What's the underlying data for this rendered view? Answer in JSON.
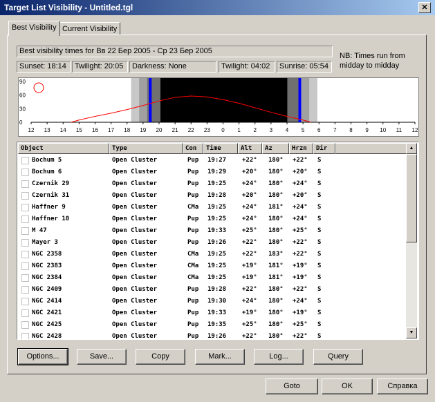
{
  "window": {
    "title": "Target List Visibility - Untitled.tgl",
    "close_glyph": "✕"
  },
  "tabs": [
    {
      "label": "Best Visibility"
    },
    {
      "label": "Current Visibility"
    }
  ],
  "info": {
    "header": "Best visibility times for Вв 22 Бер 2005 - Ср 23 Бер 2005",
    "sunset": "Sunset: 18:14",
    "twilight_evening": "Twilight: 20:05",
    "darkness": "Darkness: None",
    "twilight_morning": "Twilight: 04:02",
    "sunrise": "Sunrise: 05:54",
    "note": "NB: Times run from midday to midday"
  },
  "chart_data": {
    "type": "line",
    "y_ticks": [
      "90",
      "60",
      "30",
      "0"
    ],
    "x_ticks": [
      "12",
      "13",
      "14",
      "15",
      "16",
      "17",
      "18",
      "19",
      "20",
      "21",
      "22",
      "23",
      "0",
      "1",
      "2",
      "3",
      "4",
      "5",
      "6",
      "7",
      "8",
      "9",
      "10",
      "11",
      "12"
    ],
    "ylim": [
      0,
      90
    ],
    "x_hours": [
      14.5,
      15,
      16,
      17,
      18,
      19,
      20,
      21,
      22,
      23,
      0,
      1,
      2,
      3,
      4,
      5,
      5.5
    ],
    "altitude": [
      0,
      5,
      13,
      20,
      28,
      37,
      47,
      55,
      58,
      56,
      50,
      42,
      32,
      22,
      13,
      5,
      0
    ],
    "series": [
      {
        "name": "",
        "color": "#ff0000"
      }
    ],
    "sky_shading": [
      {
        "from": 18.25,
        "to": 18.75,
        "color": "#c8c8c8"
      },
      {
        "from": 18.75,
        "to": 19.25,
        "color": "#a0a0a0"
      },
      {
        "from": 19.25,
        "to": 20.08,
        "color": "#707070"
      },
      {
        "from": 20.08,
        "to": 4.03,
        "color": "#000000"
      },
      {
        "from": 4.03,
        "to": 4.9,
        "color": "#707070"
      },
      {
        "from": 4.9,
        "to": 5.4,
        "color": "#a0a0a0"
      },
      {
        "from": 5.4,
        "to": 5.9,
        "color": "#c8c8c8"
      }
    ],
    "markers": [
      {
        "hour": 19.45,
        "color": "#0000ff"
      },
      {
        "hour": 4.8,
        "color": "#0000ff"
      }
    ],
    "moon_symbol_color": "#ff0000"
  },
  "table": {
    "columns": [
      "Object",
      "Type",
      "Con",
      "Time",
      "Alt",
      "Az",
      "Hrzn",
      "Dir"
    ],
    "rows": [
      [
        "Bochum 5",
        "Open Cluster",
        "Pup",
        "19:27",
        "+22°",
        "180°",
        "+22°",
        "S"
      ],
      [
        "Bochum 6",
        "Open Cluster",
        "Pup",
        "19:29",
        "+20°",
        "180°",
        "+20°",
        "S"
      ],
      [
        "Czernik 29",
        "Open Cluster",
        "Pup",
        "19:25",
        "+24°",
        "180°",
        "+24°",
        "S"
      ],
      [
        "Czernik 31",
        "Open Cluster",
        "Pup",
        "19:28",
        "+20°",
        "180°",
        "+20°",
        "S"
      ],
      [
        "Haffner 9",
        "Open Cluster",
        "CMa",
        "19:25",
        "+24°",
        "181°",
        "+24°",
        "S"
      ],
      [
        "Haffner 10",
        "Open Cluster",
        "Pup",
        "19:25",
        "+24°",
        "180°",
        "+24°",
        "S"
      ],
      [
        "M 47",
        "Open Cluster",
        "Pup",
        "19:33",
        "+25°",
        "180°",
        "+25°",
        "S"
      ],
      [
        "Mayer 3",
        "Open Cluster",
        "Pup",
        "19:26",
        "+22°",
        "180°",
        "+22°",
        "S"
      ],
      [
        "NGC 2358",
        "Open Cluster",
        "CMa",
        "19:25",
        "+22°",
        "183°",
        "+22°",
        "S"
      ],
      [
        "NGC 2383",
        "Open Cluster",
        "CMa",
        "19:25",
        "+19°",
        "181°",
        "+19°",
        "S"
      ],
      [
        "NGC 2384",
        "Open Cluster",
        "CMa",
        "19:25",
        "+19°",
        "181°",
        "+19°",
        "S"
      ],
      [
        "NGC 2409",
        "Open Cluster",
        "Pup",
        "19:28",
        "+22°",
        "180°",
        "+22°",
        "S"
      ],
      [
        "NGC 2414",
        "Open Cluster",
        "Pup",
        "19:30",
        "+24°",
        "180°",
        "+24°",
        "S"
      ],
      [
        "NGC 2421",
        "Open Cluster",
        "Pup",
        "19:33",
        "+19°",
        "180°",
        "+19°",
        "S"
      ],
      [
        "NGC 2425",
        "Open Cluster",
        "Pup",
        "19:35",
        "+25°",
        "180°",
        "+25°",
        "S"
      ],
      [
        "NGC 2428",
        "Open Cluster",
        "Pup",
        "19:26",
        "+22°",
        "180°",
        "+22°",
        "S"
      ]
    ],
    "scroll_up_glyph": "▲",
    "scroll_down_glyph": "▼"
  },
  "buttons": {
    "options": "Options...",
    "save": "Save...",
    "copy": "Copy",
    "mark": "Mark...",
    "log": "Log...",
    "query": "Query"
  },
  "footer": {
    "goto": "Goto",
    "ok": "OK",
    "help": "Справка"
  }
}
